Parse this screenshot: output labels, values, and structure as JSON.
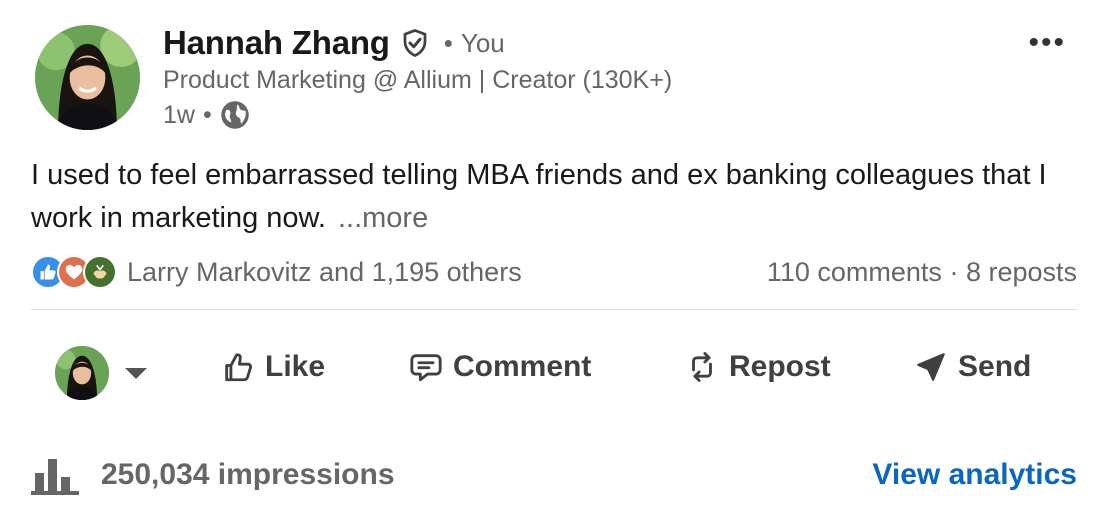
{
  "author": {
    "name": "Hannah Zhang",
    "relation": "You",
    "headline": "Product Marketing @ Allium | Creator (130K+)",
    "time": "1w",
    "visibility_icon": "globe-icon",
    "badge_icon": "verified-shield-icon"
  },
  "post": {
    "text": "I used to feel embarrassed telling MBA friends and ex banking colleagues that I work in marketing now.",
    "see_more": "...more"
  },
  "social": {
    "reaction_icons": [
      "like-icon",
      "love-icon",
      "support-icon"
    ],
    "reactors": "Larry Markovitz and 1,195 others",
    "comments": "110 comments",
    "reposts": "8 reposts"
  },
  "actions": {
    "like": "Like",
    "comment": "Comment",
    "repost": "Repost",
    "send": "Send"
  },
  "analytics": {
    "impressions": "250,034 impressions",
    "view_analytics": "View analytics"
  },
  "colors": {
    "link": "#0a66c2",
    "muted": "#666666",
    "like_blue": "#378fe9",
    "love_red": "#df704d",
    "support_green": "#44712e"
  }
}
